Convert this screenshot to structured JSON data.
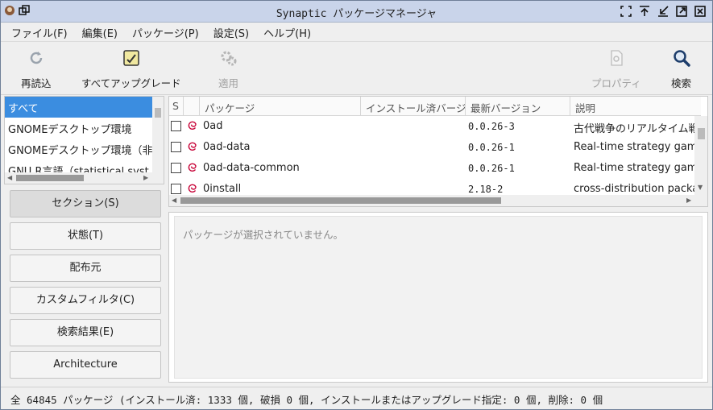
{
  "window": {
    "title": "Synaptic パッケージマネージャ"
  },
  "menu": [
    "ファイル(F)",
    "編集(E)",
    "パッケージ(P)",
    "設定(S)",
    "ヘルプ(H)"
  ],
  "toolbar": {
    "reload": "再読込",
    "upgrade_all": "すべてアップグレード",
    "apply": "適用",
    "properties": "プロパティ",
    "search": "検索"
  },
  "categories": [
    "すべて",
    "GNOMEデスクトップ環境",
    "GNOMEデスクトップ環境（非",
    "GNU R言語（statistical syst"
  ],
  "filters": [
    "セクション(S)",
    "状態(T)",
    "配布元",
    "カスタムフィルタ(C)",
    "検索結果(E)",
    "Architecture"
  ],
  "columns": {
    "status": "S",
    "package": "パッケージ",
    "installed": "インストール済バージョン",
    "latest": "最新バージョン",
    "description": "説明"
  },
  "packages": [
    {
      "name": "0ad",
      "installed": "",
      "latest": "0.0.26-3",
      "description": "古代戦争のリアルタイム戦略ゲーム"
    },
    {
      "name": "0ad-data",
      "installed": "",
      "latest": "0.0.26-1",
      "description": "Real-time strategy game"
    },
    {
      "name": "0ad-data-common",
      "installed": "",
      "latest": "0.0.26-1",
      "description": "Real-time strategy game"
    },
    {
      "name": "0install",
      "installed": "",
      "latest": "2.18-2",
      "description": "cross-distribution packaging"
    }
  ],
  "detail": {
    "empty_message": "パッケージが選択されていません。"
  },
  "status_bar": "全 64845 パッケージ (インストール済: 1333 個, 破損 0 個, インストールまたはアップグレード指定: 0 個, 削除: 0 個",
  "colors": {
    "selection": "#3b8de0",
    "titlebar": "#c9d4ea",
    "debian_swirl": "#c70036"
  },
  "icons": {
    "reload": "reload-icon",
    "upgrade_all": "upgrade-all-icon",
    "apply": "apply-icon",
    "properties": "properties-icon",
    "search": "magnifier-icon",
    "package_source": "debian-swirl-icon"
  }
}
